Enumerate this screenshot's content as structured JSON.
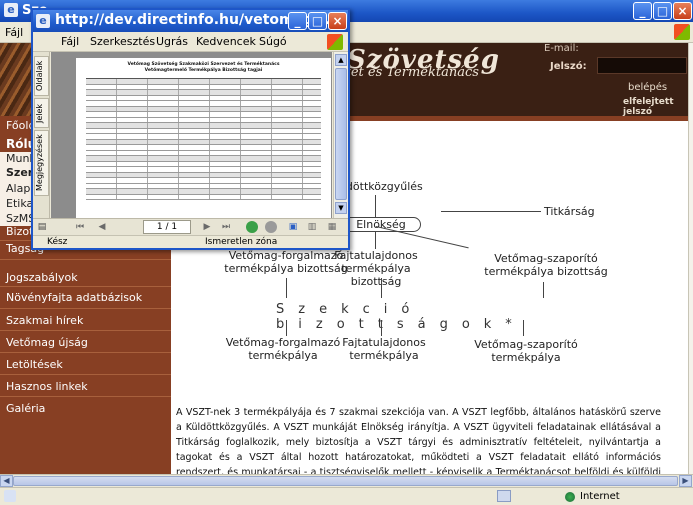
{
  "back_window": {
    "title": "Sze",
    "menu": [
      "Fájl"
    ]
  },
  "site": {
    "title_fragment": "Szövetség",
    "subtitle_fragment": "zet és Terméktanács",
    "login_hint": "E-mail:",
    "login_label": "Jelszó:",
    "login_button": "belépés",
    "forgot_link": "elfelejtett jelszó"
  },
  "nav": {
    "top_item": "Főold",
    "section_title": "Rólun",
    "sub_items": [
      "Munk",
      "Szer",
      "Alapí",
      "Etikai",
      "SzMS"
    ],
    "items": [
      "Bizott",
      "Tagság",
      "Jogszabályok",
      "Növényfajta adatbázisok",
      "Szakmai hírek",
      "Vetőmag újság",
      "Letöltések",
      "Hasznos linkek",
      "Galéria"
    ]
  },
  "org_chart": {
    "kuldott": "Küldöttközgyűlés",
    "titkarsag": "Titkárság",
    "elnokseg": "Elnökség",
    "forg_biz": "Vetőmag-forgalmazó\ntermékpálya bizottság",
    "fajta_biz": "Fajtatulajdonos\ntermékpálya bizottság",
    "szap_biz": "Vetőmag-szaporító\ntermékpálya bizottság",
    "szekcio": "Szekció bizottságok*",
    "forg_tp": "Vetőmag-forgalmazó\ntermékpálya",
    "fajta_tp": "Fajtatulajdonos\ntermékpálya",
    "szap_tp": "Vetőmag-szaporító\ntermékpálya"
  },
  "description": "A VSZT-nek 3 termékpályája és 7 szakmai szekciója van. A VSZT legfőbb, általános hatáskörű szerve a Küldöttközgyűlés. A VSZT munkáját Elnökség irányítja. A VSZT ügyviteli feladatainak ellátásával a Titkárság foglalkozik, mely biztosítja a VSZT tárgyi és adminisztratív feltételeit, nyilvántartja a tagokat és a VSZT által hozott határozatokat, működteti a VSZT feladatait ellátó információs rendszert, és munkatársai - a tisztségviselők mellett - képviselik a Terméktanácsot belföldi és külföldi események.",
  "status_bar": {
    "zone": "Internet"
  },
  "popup": {
    "title": "http://dev.directinfo.hu/vetomagt...",
    "menu": [
      "Fájl",
      "Szerkesztés",
      "Ugrás",
      "Kedvencek",
      "Súgó"
    ],
    "side_tabs": [
      "Oldalak",
      "Jelek",
      "Megjegyzések"
    ],
    "pdf_title": "Vetőmag Szövetség Szakmaközi Szervezet és Terméktanács\nVetőmagtermelő Termékpálya Bizottság tagjai",
    "page_indicator": "1 / 1",
    "status_left": "Kész",
    "status_zone": "Ismeretlen zóna"
  },
  "colors": {
    "nav_bg": "#873f23",
    "header_bg": "#3a2014",
    "titlebar": "#1f5ccc"
  }
}
